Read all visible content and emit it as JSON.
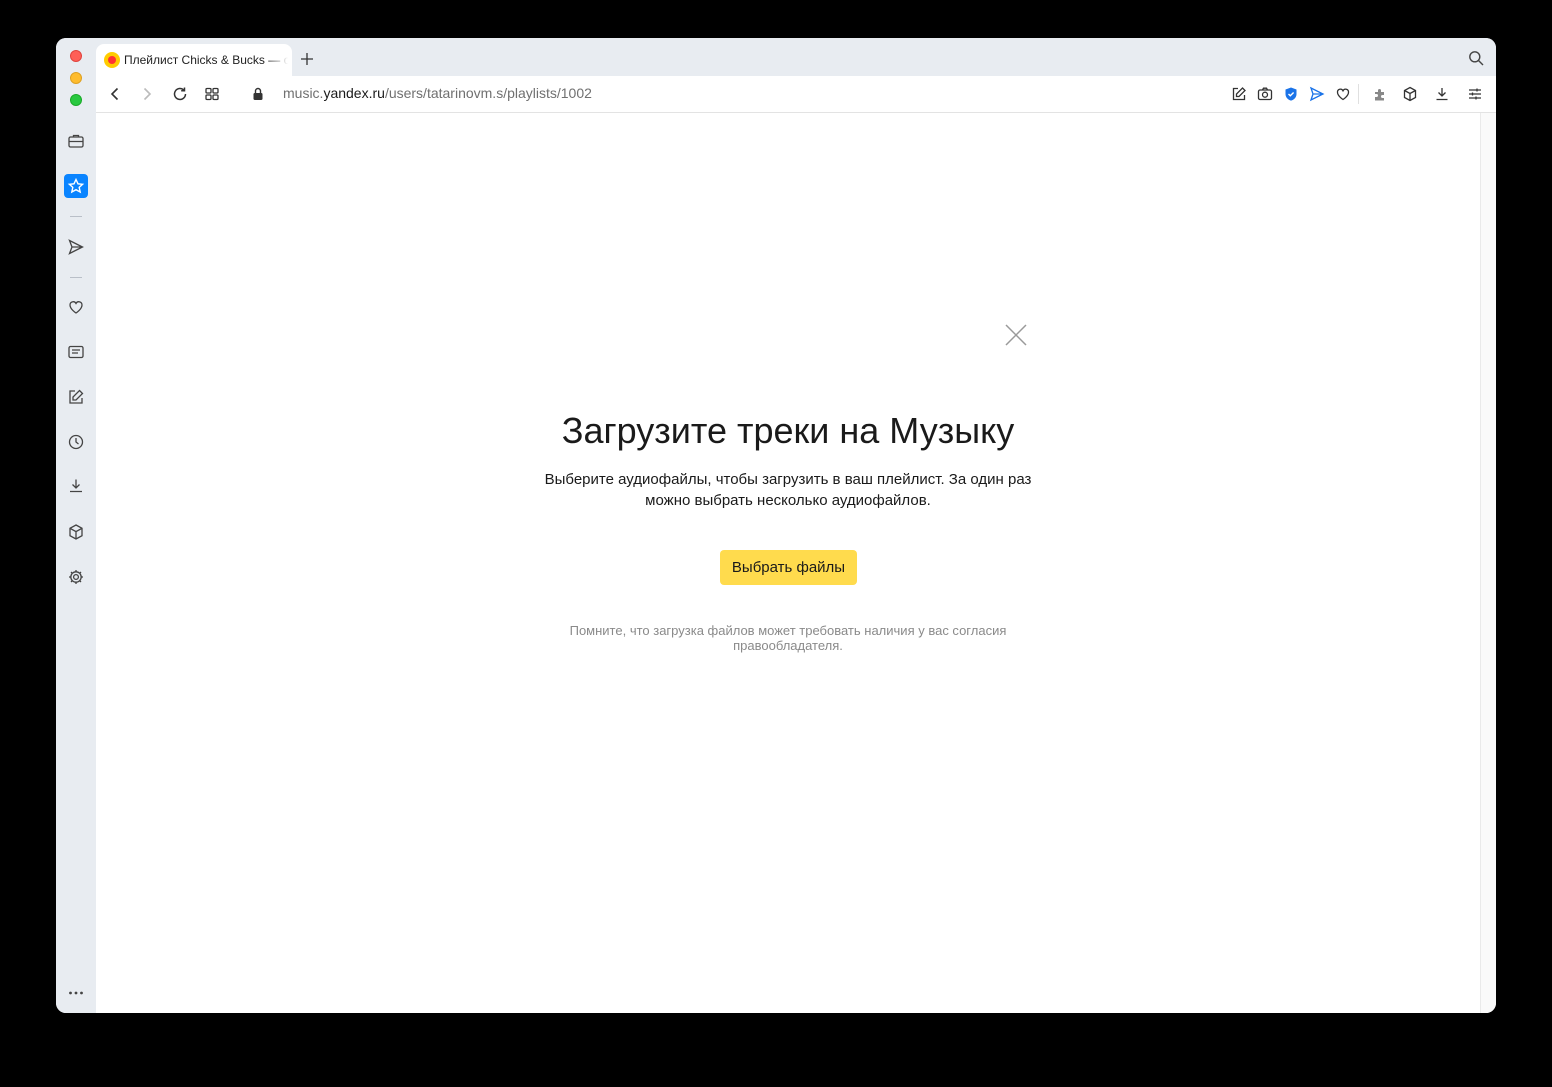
{
  "browser": {
    "tab": {
      "title": "Плейлист Chicks & Bucks — слушать онлайн на Яндекс Музыке"
    },
    "url": {
      "prefix": "music.",
      "host": "yandex.ru",
      "path": "/users/tatarinovm.s/playlists/1002"
    },
    "sidebar_icons": [
      "briefcase-icon",
      "star-icon",
      "send-icon",
      "heart-icon",
      "news-icon",
      "edit-icon",
      "clock-icon",
      "download-icon",
      "cube-icon",
      "gear-icon",
      "more-icon"
    ],
    "toolbar_icons": [
      "back-icon",
      "forward-icon",
      "reload-icon",
      "tabs-grid-icon",
      "lock-icon",
      "edit-icon",
      "camera-icon",
      "shield-icon",
      "send-icon",
      "heart-icon",
      "extension-icon",
      "cube-icon",
      "download-icon",
      "settings-icon"
    ],
    "accent_color": "#0a84ff"
  },
  "upload_dialog": {
    "title": "Загрузите треки на Музыку",
    "description": "Выберите аудиофайлы, чтобы загрузить в ваш плейлист. За один раз можно выбрать несколько аудиофайлов.",
    "button_label": "Выбрать файлы",
    "button_color": "#ffdb4d",
    "note": "Помните, что загрузка файлов может требовать наличия у вас согласия правообладателя."
  }
}
